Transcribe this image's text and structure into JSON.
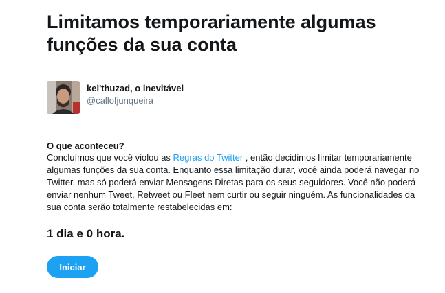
{
  "title": "Limitamos temporariamente algumas funções da sua conta",
  "account": {
    "display_name": "kel'thuzad, o inevitável",
    "handle": "@callofjunqueira"
  },
  "section": {
    "heading": "O que aconteceu?",
    "lines": [
      {
        "before": "Concluímos que você violou as ",
        "link": "Regras do Twitter",
        "after": " , então decidimos limitar temporariamente"
      },
      "algumas funções da sua conta. Enquanto essa limitação durar, você ainda poderá navegar no",
      "Twitter, mas só poderá enviar Mensagens Diretas para os seus seguidores. Você não poderá",
      "enviar nenhum Tweet, Retweet ou Fleet nem curtir ou seguir ninguém. As funcionalidades da",
      "sua conta serão totalmente restabelecidas em:"
    ]
  },
  "duration": "1 dia e 0 hora.",
  "start_button_label": "Iniciar",
  "colors": {
    "accent": "#1da1f2",
    "text": "#14171a",
    "secondary_text": "#657786"
  }
}
